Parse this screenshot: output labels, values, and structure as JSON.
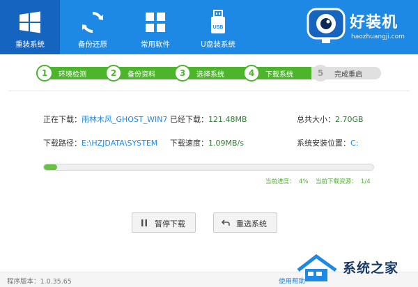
{
  "nav": {
    "items": [
      {
        "label": "重装系统",
        "icon": "windows-icon",
        "active": true
      },
      {
        "label": "备份还原",
        "icon": "refresh-icon",
        "active": false
      },
      {
        "label": "常用软件",
        "icon": "apps-grid-icon",
        "active": false
      },
      {
        "label": "U盘装系统",
        "icon": "usb-icon",
        "active": false
      }
    ]
  },
  "brand": {
    "name": "好装机",
    "url": "haozhuangji.com",
    "icon": "eye-monitor-logo"
  },
  "steps": [
    {
      "num": "1",
      "label": "环境检测",
      "state": "done"
    },
    {
      "num": "2",
      "label": "备份资料",
      "state": "done"
    },
    {
      "num": "3",
      "label": "选择系统",
      "state": "done"
    },
    {
      "num": "4",
      "label": "下载系统",
      "state": "active"
    },
    {
      "num": "5",
      "label": "完成重启",
      "state": "pending"
    }
  ],
  "download": {
    "downloading_label": "正在下载：",
    "downloading_name": "雨林木风_GHOST_WIN7",
    "downloaded_label": "已经下载：",
    "downloaded_value": "121.48MB",
    "total_label": "总共大小：",
    "total_value": "2.70GB",
    "path_label": "下载路径：",
    "path_value": "E:\\HZJDATA\\SYSTEM",
    "speed_label": "下载速度：",
    "speed_value": "1.09MB/s",
    "install_label": "系统安装位置：",
    "install_value": "C:",
    "progress_percent": 4,
    "progress_label": "当前进度：",
    "progress_text": "4%",
    "resource_label": "当前下载资源：",
    "resource_text": "1/4"
  },
  "buttons": {
    "pause": "暂停下载",
    "reselect": "重选系统"
  },
  "footer": {
    "version": "程序版本：1.0.35.65",
    "help": "使用帮助"
  },
  "watermark": {
    "text": "系统之家"
  },
  "colors": {
    "header": "#1e88e5",
    "accent_green": "#4cb52c",
    "link_blue": "#1e88e5"
  }
}
